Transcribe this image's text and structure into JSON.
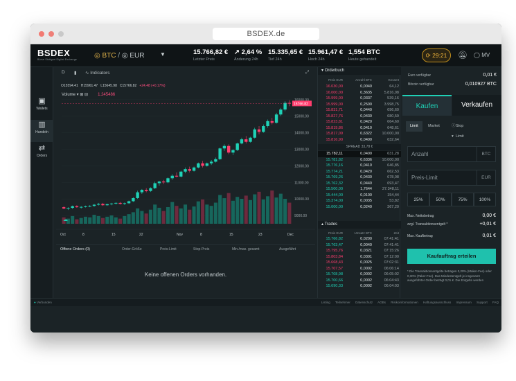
{
  "browser": {
    "url": "BSDEX.de"
  },
  "header": {
    "logo": "BSDEX",
    "logo_sub": "Börse Stuttgart Digital Exchange",
    "pair_base": "BTC",
    "pair_quote": "EUR",
    "stats": [
      {
        "value": "15.766,82 €",
        "label": "Letzter Preis"
      },
      {
        "value": "2,64 %",
        "label": "Änderung 24h"
      },
      {
        "value": "15.335,65 €",
        "label": "Tief 24h"
      },
      {
        "value": "15.961,47 €",
        "label": "Hoch 24h"
      },
      {
        "value": "1,554 BTC",
        "label": "Heute gehandelt"
      }
    ],
    "timer": "29:21",
    "user": "MV"
  },
  "sidebar": [
    {
      "label": "Wallets",
      "icon": "wallet-icon"
    },
    {
      "label": "Handeln",
      "icon": "chart-icon"
    },
    {
      "label": "Orders",
      "icon": "swap-icon"
    }
  ],
  "chart_toolbar": {
    "interval": "D",
    "indicators": "Indicators"
  },
  "ohlc": {
    "o": "O15594.41",
    "h": "H15961.47",
    "l": "L15645.98",
    "c": "C15766.82",
    "chg": "+24.48 (+0.17%)"
  },
  "volume": {
    "label": "Volume",
    "value": "1.245486"
  },
  "chart_data": {
    "type": "candlestick",
    "x_ticks": [
      "Oct",
      "8",
      "15",
      "22",
      "Nov",
      "8",
      "15",
      "23",
      "Dec"
    ],
    "y_ticks": [
      "16000.00",
      "15000.00",
      "14000.00",
      "13000.00",
      "12000.00",
      "11000.00",
      "10000.00",
      "9000.00"
    ],
    "ylim": [
      8500,
      16200
    ],
    "last_price_label": "15766.82",
    "candles": [
      [
        9500,
        9560,
        9380,
        9420
      ],
      [
        9420,
        9500,
        9330,
        9460
      ],
      [
        9460,
        9600,
        9400,
        9560
      ],
      [
        9560,
        9620,
        9460,
        9500
      ],
      [
        9500,
        9560,
        9420,
        9520
      ],
      [
        9520,
        9600,
        9480,
        9550
      ],
      [
        9550,
        9620,
        9500,
        9580
      ],
      [
        9580,
        9700,
        9520,
        9650
      ],
      [
        9650,
        9760,
        9600,
        9700
      ],
      [
        9700,
        9760,
        9580,
        9620
      ],
      [
        9620,
        9720,
        9580,
        9680
      ],
      [
        9680,
        9760,
        9620,
        9720
      ],
      [
        9720,
        9800,
        9660,
        9760
      ],
      [
        9760,
        9820,
        9660,
        9700
      ],
      [
        9700,
        9780,
        9640,
        9740
      ],
      [
        9740,
        9900,
        9700,
        9860
      ],
      [
        9860,
        10100,
        9820,
        10050
      ],
      [
        10050,
        10500,
        10000,
        10400
      ],
      [
        10400,
        10600,
        10300,
        10550
      ],
      [
        10550,
        10650,
        10400,
        10480
      ],
      [
        10480,
        10700,
        10420,
        10650
      ],
      [
        10650,
        11050,
        10600,
        10950
      ],
      [
        10950,
        11100,
        10800,
        11050
      ],
      [
        11050,
        11150,
        10900,
        11000
      ],
      [
        11000,
        11300,
        10950,
        11250
      ],
      [
        11250,
        11500,
        11150,
        11400
      ],
      [
        11400,
        11600,
        11300,
        11350
      ],
      [
        11350,
        11700,
        11300,
        11650
      ],
      [
        11650,
        11900,
        11550,
        11800
      ],
      [
        11800,
        11950,
        11600,
        11700
      ],
      [
        11700,
        11950,
        11650,
        11900
      ],
      [
        11900,
        12200,
        11850,
        12150
      ],
      [
        12150,
        12300,
        11900,
        12000
      ],
      [
        12000,
        12200,
        11950,
        12150
      ],
      [
        12150,
        12350,
        12050,
        12250
      ],
      [
        12250,
        12500,
        12200,
        12400
      ],
      [
        12400,
        13100,
        12350,
        13050
      ],
      [
        13050,
        13300,
        12900,
        13200
      ],
      [
        13200,
        13300,
        12700,
        12800
      ],
      [
        12800,
        13000,
        12650,
        12950
      ],
      [
        12950,
        13400,
        12900,
        13350
      ],
      [
        13350,
        13700,
        13300,
        13600
      ],
      [
        13600,
        13800,
        13350,
        13450
      ],
      [
        13450,
        13750,
        13400,
        13700
      ],
      [
        13700,
        14300,
        13650,
        14200
      ],
      [
        14200,
        14400,
        13900,
        14050
      ],
      [
        14050,
        14500,
        14000,
        14400
      ],
      [
        14400,
        14800,
        14300,
        14700
      ],
      [
        14700,
        14900,
        14500,
        14600
      ],
      [
        14600,
        15200,
        14550,
        15100
      ],
      [
        15100,
        15500,
        15000,
        15400
      ],
      [
        15400,
        15900,
        15300,
        15800
      ],
      [
        15800,
        15960,
        15600,
        15767
      ]
    ],
    "volumes": [
      10,
      8,
      12,
      7,
      9,
      11,
      10,
      14,
      12,
      9,
      11,
      13,
      10,
      8,
      12,
      15,
      18,
      24,
      20,
      16,
      22,
      30,
      25,
      20,
      26,
      34,
      28,
      24,
      30,
      22,
      27,
      35,
      38,
      30,
      28,
      33,
      45,
      40,
      48,
      36,
      42,
      39,
      44,
      37,
      46,
      50,
      38,
      43,
      52,
      41,
      47,
      39,
      33
    ]
  },
  "open_orders": {
    "title": "Offene Orders (0)",
    "cols": [
      "Order-Größe",
      "Preis-Limit",
      "Stop-Preis",
      "Min./max. gesamt",
      "Ausgeführt"
    ],
    "empty": "Keine offenen Orders vorhanden."
  },
  "orderbook": {
    "title": "Orderbuch",
    "cols": [
      "Preis EUR",
      "Anzahl BTC",
      "Gesamt"
    ],
    "asks": [
      [
        "16.030,00",
        "0,0040",
        "64,12"
      ],
      [
        "16.000,00",
        "0,3635",
        "5.816,08"
      ],
      [
        "15.999,00",
        "0,0337",
        "539,16"
      ],
      [
        "15.999,00",
        "0,2500",
        "3.998,75"
      ],
      [
        "15.831,71",
        "0,0440",
        "696,60"
      ],
      [
        "15.827,76",
        "0,0430",
        "680,59"
      ],
      [
        "15.823,81",
        "0,0420",
        "664,60"
      ],
      [
        "15.819,86",
        "0,0410",
        "648,61"
      ],
      [
        "15.817,09",
        "0,6322",
        "10.000,00"
      ],
      [
        "15.816,90",
        "0,0400",
        "632,64"
      ]
    ],
    "spread": "SPREAD 33,78 €",
    "bids": [
      [
        "15.782,11",
        "0,0400",
        "631,28"
      ],
      [
        "15.781,82",
        "0,6336",
        "10.000,00"
      ],
      [
        "15.776,16",
        "0,0410",
        "646,85"
      ],
      [
        "15.774,21",
        "0,0420",
        "662,53"
      ],
      [
        "15.769,26",
        "0,0430",
        "678,08"
      ],
      [
        "15.762,32",
        "0,0440",
        "693,47"
      ],
      [
        "15.500,00",
        "1,7644",
        "27.348,11"
      ],
      [
        "15.444,00",
        "0,0100",
        "154,44"
      ],
      [
        "15.374,00",
        "0,0035",
        "53,82"
      ],
      [
        "15.000,00",
        "0,0240",
        "367,20"
      ]
    ]
  },
  "trades": {
    "title": "Trades",
    "cols": [
      "Preis EUR",
      "Umsatz BTC",
      "Zeit"
    ],
    "rows": [
      [
        "15.766,82",
        "0,0200",
        "07:41:41",
        "g"
      ],
      [
        "15.763,47",
        "0,0040",
        "07:41:41",
        "g"
      ],
      [
        "15.795,76",
        "0,0321",
        "07:15:26",
        "r"
      ],
      [
        "15.803,84",
        "0,0301",
        "07:12:00",
        "r"
      ],
      [
        "15.668,43",
        "0,0025",
        "07:02:31",
        "r"
      ],
      [
        "15.707,57",
        "0,0002",
        "06:06:14",
        "r"
      ],
      [
        "15.708,98",
        "0,0002",
        "06:05:02",
        "g"
      ],
      [
        "15.700,66",
        "0,0002",
        "06:04:43",
        "g"
      ],
      [
        "15.690,33",
        "0,0002",
        "06:04:03",
        "g"
      ]
    ]
  },
  "buy_panel": {
    "bal_eur_label": "Euro verfügbar",
    "bal_eur": "0,01 €",
    "bal_btc_label": "Bitcoin verfügbar",
    "bal_btc": "0,010927 BTC",
    "tab_buy": "Kaufen",
    "tab_sell": "Verkaufen",
    "order_types": [
      "Limit",
      "Market",
      "Stop Limit"
    ],
    "amount_ph": "Anzahl",
    "amount_unit": "BTC",
    "limit_ph": "Preis-Limit",
    "limit_unit": "EUR",
    "pcts": [
      "25%",
      "50%",
      "75%",
      "100%"
    ],
    "net_label": "Max. Nettobetrag",
    "net_value": "0,00 €",
    "fee_label": "zzgl. Transaktionsentgelt *",
    "fee_value": "+0,01 €",
    "max_label": "Max. Kaufbetrag",
    "max_value": "0,01 €",
    "cta": "Kaufauftrag erteilen",
    "note": "* Die Transaktionsentgelte betragen 0,20% (Maker-Fee) oder 0,30% (Taker-Fee). Das Mindestentgelt je insgesamt ausgeführter Order beträgt 0,01 €. Die Entgelte werden"
  },
  "footer": {
    "status": "Verbunden",
    "links": "Listing Teilnehmer Datenschutz AGBs Risikoinformationen Haftungsausschluss Impressum Support FAQ"
  },
  "colors": {
    "up": "#1fd1b6",
    "down": "#ff3d6e",
    "accent": "#1fc1ad",
    "bg": "#1b2326"
  }
}
